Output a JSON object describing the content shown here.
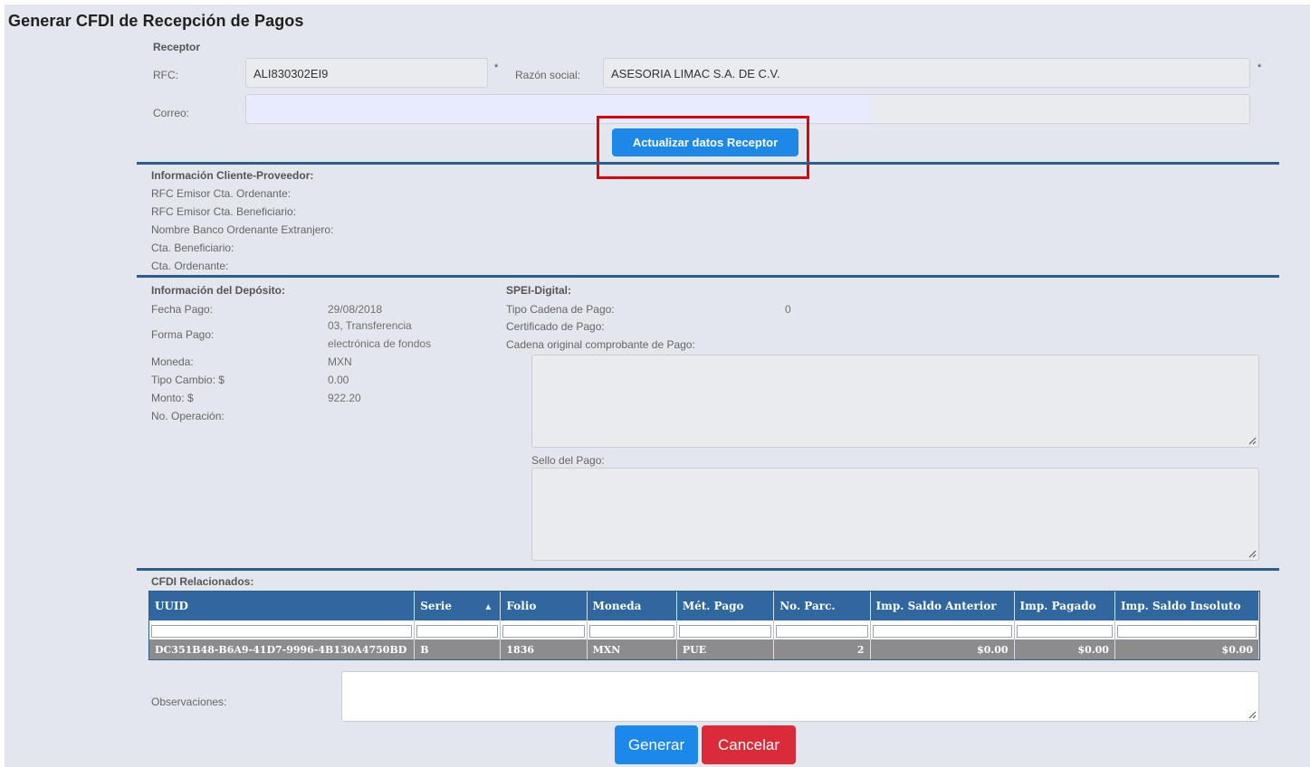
{
  "title": "Generar CFDI de Recepción de Pagos",
  "receptor": {
    "section_label": "Receptor",
    "rfc_label": "RFC:",
    "rfc_value": "ALI830302EI9",
    "required_mark": "*",
    "razon_label": "Razón social:",
    "razon_value": "ASESORIA LIMAC S.A. DE C.V.",
    "correo_label": "Correo:",
    "correo_value": "",
    "update_button": "Actualizar datos Receptor"
  },
  "cliente_proveedor": {
    "heading": "Información Cliente-Proveedor:",
    "rfc_emisor_ordenante": "RFC Emisor Cta. Ordenante:",
    "rfc_emisor_beneficiario": "RFC Emisor Cta. Beneficiario:",
    "nombre_banco": "Nombre Banco Ordenante Extranjero:",
    "cta_beneficiario": "Cta. Beneficiario:",
    "cta_ordenante": "Cta. Ordenante:"
  },
  "deposito": {
    "heading": "Información del Depósito:",
    "fecha_label": "Fecha Pago:",
    "fecha_value": "29/08/2018",
    "forma_label": "Forma Pago:",
    "forma_value_line1": "03, Transferencia",
    "forma_value_line2": "electrónica de fondos",
    "moneda_label": "Moneda:",
    "moneda_value": "MXN",
    "tipo_cambio_label": "Tipo Cambio: $",
    "tipo_cambio_value": "0.00",
    "monto_label": "Monto: $",
    "monto_value": "922.20",
    "operacion_label": "No. Operación:"
  },
  "spei": {
    "heading": "SPEI-Digital:",
    "tipo_cadena_label": "Tipo Cadena de Pago:",
    "tipo_cadena_value": "0",
    "certificado_label": "Certificado de Pago:",
    "cadena_original_label": "Cadena original comprobante de Pago:",
    "sello_label": "Sello del Pago:"
  },
  "cfdi": {
    "heading": "CFDI Relacionados:",
    "columns": [
      "UUID",
      "Serie",
      "Folio",
      "Moneda",
      "Mét. Pago",
      "No. Parc.",
      "Imp. Saldo Anterior",
      "Imp. Pagado",
      "Imp. Saldo Insoluto"
    ],
    "rows": [
      [
        "DC351B48-B6A9-41D7-9996-4B130A4750BD",
        "B",
        "1836",
        "MXN",
        "PUE",
        "2",
        "$0.00",
        "$0.00",
        "$0.00"
      ]
    ]
  },
  "observaciones_label": "Observaciones:",
  "generar_label": "Generar",
  "cancelar_label": "Cancelar",
  "colors": {
    "primary": "#1e88e8",
    "danger": "#db2b39",
    "header": "#30679e",
    "highlight": "#e00000"
  }
}
